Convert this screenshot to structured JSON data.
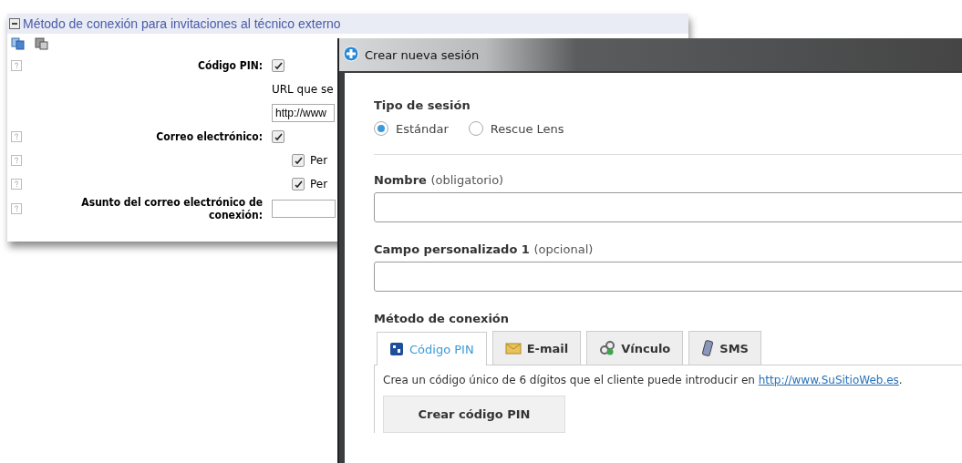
{
  "settings_panel": {
    "header": "Método de conexión para invitaciones al técnico externo",
    "expanded": true,
    "rows": [
      {
        "kind": "check",
        "label": "Código PIN:",
        "checked": true,
        "help": true
      },
      {
        "kind": "text",
        "label": "URL que se"
      },
      {
        "kind": "input",
        "value": "http://www"
      },
      {
        "kind": "check",
        "label": "Correo electrónico:",
        "checked": true,
        "help": true
      },
      {
        "kind": "subcheck",
        "label": "Per",
        "checked": true,
        "help": true
      },
      {
        "kind": "subcheck",
        "label": "Per",
        "checked": true,
        "help": true
      },
      {
        "kind": "field",
        "label": "Asunto del correo electrónico de conexión:",
        "help": true
      }
    ]
  },
  "dialog": {
    "title": "Crear nueva sesión",
    "session_type": {
      "label": "Tipo de sesión",
      "options": [
        {
          "label": "Estándar",
          "selected": true
        },
        {
          "label": "Rescue Lens",
          "selected": false
        }
      ]
    },
    "fields": [
      {
        "label": "Nombre",
        "hint": "(obligatorio)"
      },
      {
        "label": "Campo personalizado 1",
        "hint": "(opcional)"
      }
    ],
    "method_label": "Método de conexión",
    "tabs": [
      {
        "label": "Código PIN",
        "kind": "pin",
        "selected": true
      },
      {
        "label": "E-mail",
        "kind": "email",
        "selected": false
      },
      {
        "label": "Vínculo",
        "kind": "link",
        "selected": false
      },
      {
        "label": "SMS",
        "kind": "sms",
        "selected": false
      }
    ],
    "description": "Crea un código único de 6 dígitos que el cliente puede introducir en",
    "link": "http://www.SuSitioWeb.es",
    "description_end": ".",
    "button": "Crear código PIN"
  }
}
